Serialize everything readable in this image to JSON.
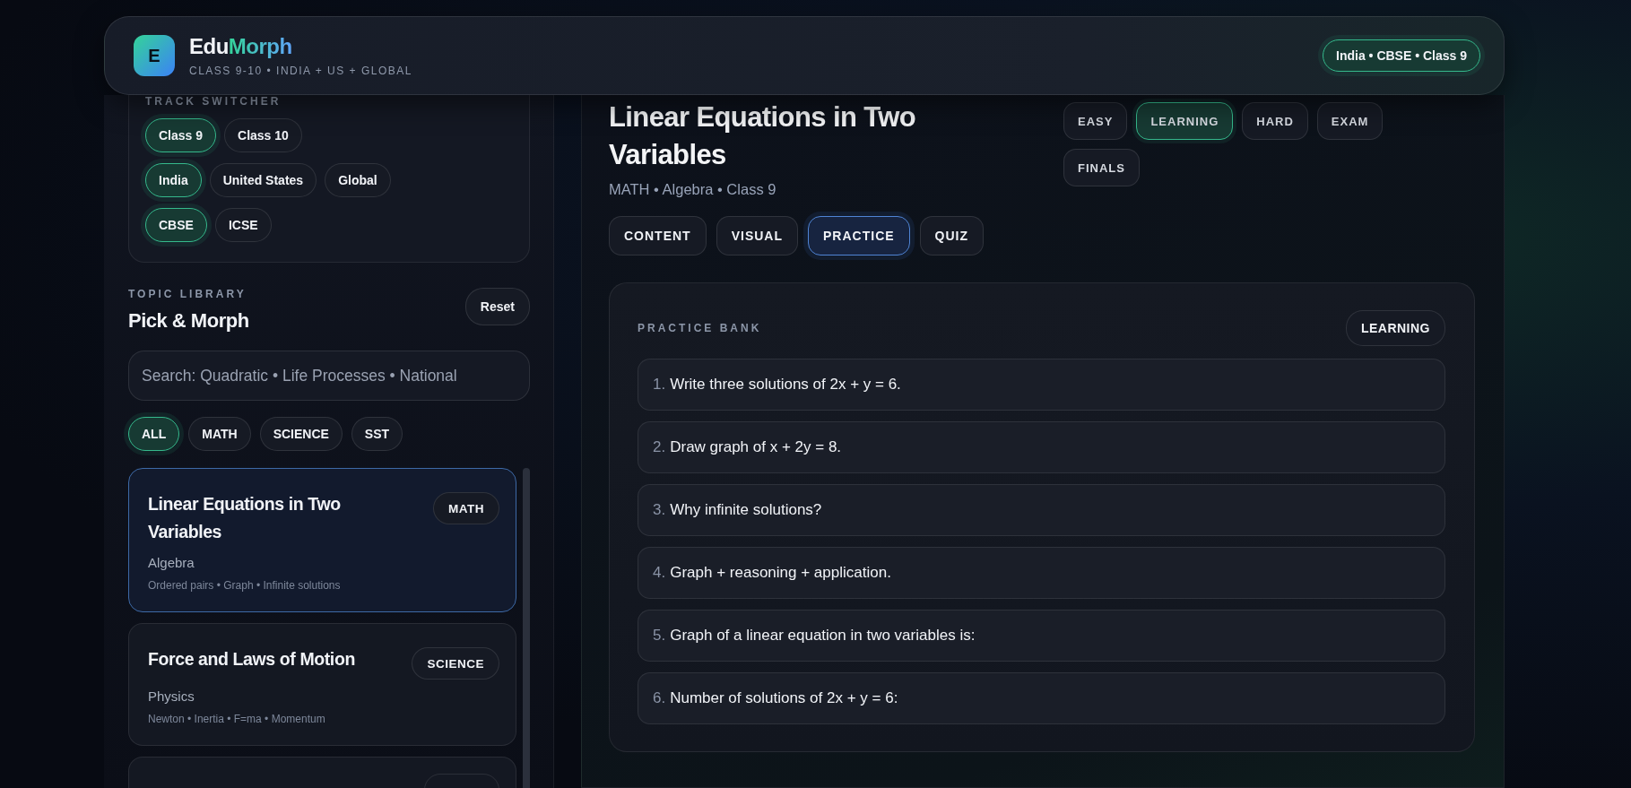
{
  "brand": {
    "logo_letter": "E",
    "name_parts": [
      {
        "text": "Edu",
        "kind": "plain"
      },
      {
        "text": "Morph",
        "kind": "gradient"
      }
    ],
    "tagline": "CLASS 9-10 • INDIA + US + GLOBAL"
  },
  "track_badge": "India • CBSE • Class 9",
  "track_switcher": {
    "label": "TRACK SWITCHER",
    "groups": [
      [
        {
          "label": "Class 9",
          "selected": true
        },
        {
          "label": "Class 10",
          "selected": false
        }
      ],
      [
        {
          "label": "India",
          "selected": true
        },
        {
          "label": "United States",
          "selected": false
        },
        {
          "label": "Global",
          "selected": false
        }
      ],
      [
        {
          "label": "CBSE",
          "selected": true
        },
        {
          "label": "ICSE",
          "selected": false
        }
      ]
    ]
  },
  "topic_library": {
    "label": "TOPIC LIBRARY",
    "title": "Pick & Morph",
    "reset": "Reset",
    "search": {
      "placeholder": "Search: Quadratic • Life Processes • National"
    },
    "filters": [
      {
        "label": "ALL",
        "selected": true
      },
      {
        "label": "MATH",
        "selected": false
      },
      {
        "label": "SCIENCE",
        "selected": false
      },
      {
        "label": "SST",
        "selected": false
      }
    ],
    "topics": [
      {
        "kind": "card",
        "title": "Linear Equations in Two Variables",
        "subject": "MATH",
        "chapter": "Algebra",
        "keywords": "Ordered pairs • Graph • Infinite solutions",
        "selected": true
      },
      {
        "kind": "card",
        "title": "Force and Laws of Motion",
        "subject": "SCIENCE",
        "chapter": "Physics",
        "keywords": "Newton • Inertia • F=ma • Momentum",
        "selected": false
      },
      {
        "kind": "clipped"
      }
    ]
  },
  "topic": {
    "title": "Linear Equations in Two Variables",
    "meta": "MATH • Algebra • Class 9",
    "tabs": [
      {
        "label": "CONTENT",
        "selected": false
      },
      {
        "label": "VISUAL",
        "selected": false
      },
      {
        "label": "PRACTICE",
        "selected": true
      },
      {
        "label": "QUIZ",
        "selected": false
      }
    ],
    "levels": [
      {
        "label": "EASY",
        "selected": false
      },
      {
        "label": "LEARNING",
        "selected": true
      },
      {
        "label": "HARD",
        "selected": false
      },
      {
        "label": "EXAM",
        "selected": false
      },
      {
        "label": "FINALS",
        "selected": false
      }
    ]
  },
  "practice": {
    "label": "PRACTICE BANK",
    "badge": "LEARNING",
    "questions": [
      {
        "number": "1.",
        "text": "Write three solutions of 2x + y = 6."
      },
      {
        "number": "2.",
        "text": "Draw graph of x + 2y = 8."
      },
      {
        "number": "3.",
        "text": "Why infinite solutions?"
      },
      {
        "number": "4.",
        "text": "Graph + reasoning + application."
      },
      {
        "number": "5.",
        "text": "Graph of a linear equation in two variables is:"
      },
      {
        "number": "6.",
        "text": "Number of solutions of 2x + y = 6:"
      }
    ]
  }
}
